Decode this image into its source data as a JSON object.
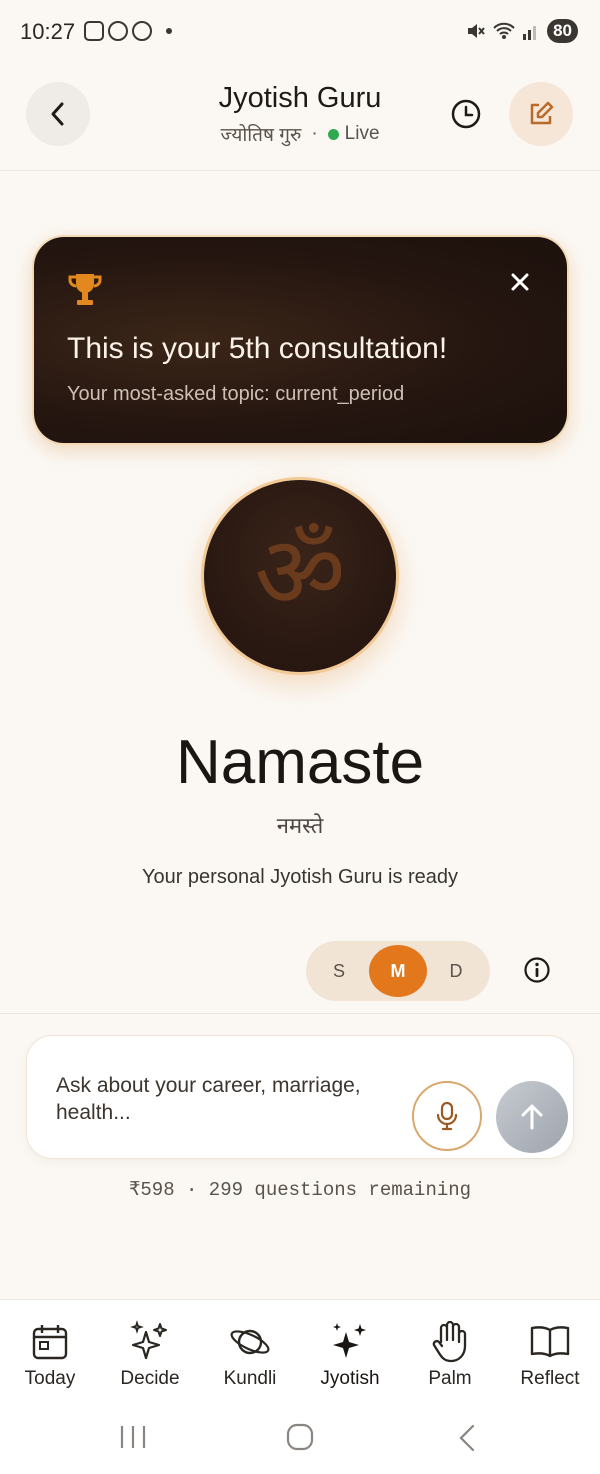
{
  "status_bar": {
    "time": "10:27",
    "battery": "80"
  },
  "header": {
    "title": "Jyotish Guru",
    "subtitle_hindi": "ज्योतिष गुरु",
    "separator": "·",
    "status": "Live",
    "status_color": "#2fa84f"
  },
  "banner": {
    "title": "This is your 5th consultation!",
    "subtitle": "Your most-asked topic: current_period"
  },
  "hero": {
    "symbol": "ॐ",
    "greeting": "Namaste",
    "greeting_hindi": "नमस्ते",
    "tagline": "Your personal Jyotish Guru is ready"
  },
  "mode_toggle": {
    "options": [
      "S",
      "M",
      "D"
    ],
    "selected": "M",
    "accent": "#e3771b"
  },
  "input": {
    "placeholder": "Ask about your career, marriage, health..."
  },
  "credits": {
    "text": "₹598 · 299 questions remaining"
  },
  "nav": {
    "items": [
      {
        "label": "Today",
        "icon": "calendar-icon"
      },
      {
        "label": "Decide",
        "icon": "sparkles-outline-icon"
      },
      {
        "label": "Kundli",
        "icon": "planet-icon"
      },
      {
        "label": "Jyotish",
        "icon": "sparkles-filled-icon"
      },
      {
        "label": "Palm",
        "icon": "hand-icon"
      },
      {
        "label": "Reflect",
        "icon": "book-icon"
      }
    ],
    "active": "Jyotish"
  }
}
